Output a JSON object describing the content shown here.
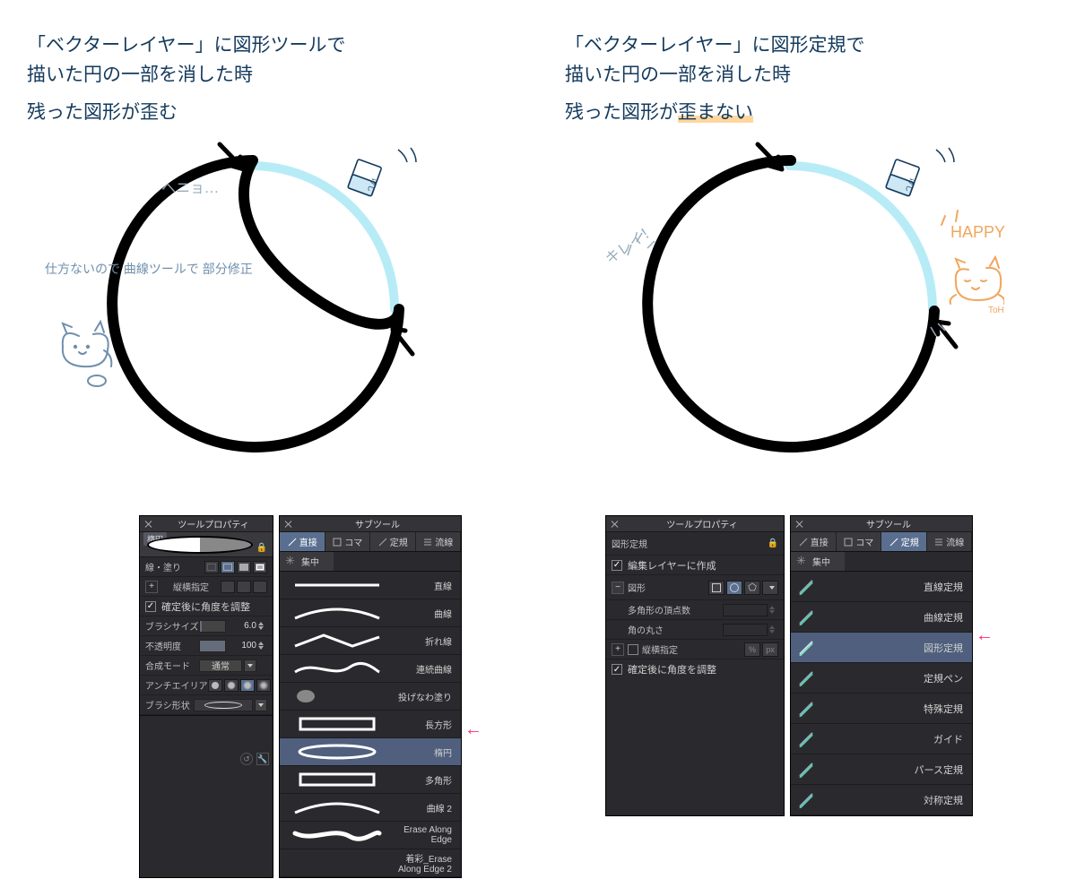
{
  "left": {
    "caption1": "「ベクターレイヤー」に図形ツールで\n描いた円の一部を消した時",
    "caption2": "残った図形が歪む",
    "note_bend": "ヘニョ…",
    "note_cat": "仕方ないので\n曲線ツールで\n部分修正",
    "eraser_label": "けし"
  },
  "right": {
    "caption1": "「ベクターレイヤー」に図形定規で\n描いた円の一部を消した時",
    "caption2_a": "残った図形が",
    "caption2_b": "歪まない",
    "note_clean": "キレイ！",
    "note_happy": "HAPPY！",
    "note_cat": "ToH.",
    "eraser_label": "けし"
  },
  "tool_property_left": {
    "panel_title": "ツールプロパティ",
    "shape_label": "楕円",
    "line_fill": "線・塗り",
    "aspect_lock": "縦横指定",
    "angle_after_fix": "確定後に角度を調整",
    "brush_size": "ブラシサイズ",
    "brush_size_val": "6.0",
    "opacity": "不透明度",
    "opacity_val": "100",
    "blend_mode": "合成モード",
    "blend_mode_val": "通常",
    "antialias": "アンチエイリア",
    "brush_shape": "ブラシ形状"
  },
  "subtool_left": {
    "panel_title": "サブツール",
    "tabs": [
      "直接",
      "コマ",
      "定規",
      "流線"
    ],
    "row2": "集中",
    "items": [
      {
        "name": "直線"
      },
      {
        "name": "曲線"
      },
      {
        "name": "折れ線"
      },
      {
        "name": "連続曲線"
      },
      {
        "name": "投げなわ塗り"
      },
      {
        "name": "長方形"
      },
      {
        "name": "楕円",
        "selected": true
      },
      {
        "name": "多角形"
      },
      {
        "name": "曲線 2"
      },
      {
        "name": "Erase Along Edge"
      },
      {
        "name": "着彩_Erase Along Edge 2"
      }
    ]
  },
  "tool_property_right": {
    "panel_title": "ツールプロパティ",
    "shape_ruler": "図形定規",
    "create_on_edit_layer": "編集レイヤーに作成",
    "shape_section": "図形",
    "polygon_vertices": "多角形の頂点数",
    "corner_round": "角の丸さ",
    "aspect_lock": "縦横指定",
    "angle_after_fix": "確定後に角度を調整"
  },
  "subtool_right": {
    "panel_title": "サブツール",
    "tabs": [
      "直接",
      "コマ",
      "定規",
      "流線"
    ],
    "row2": "集中",
    "items": [
      {
        "name": "直線定規"
      },
      {
        "name": "曲線定規"
      },
      {
        "name": "図形定規",
        "selected": true
      },
      {
        "name": "定規ペン"
      },
      {
        "name": "特殊定規"
      },
      {
        "name": "ガイド"
      },
      {
        "name": "パース定規"
      },
      {
        "name": "対称定規"
      }
    ]
  }
}
